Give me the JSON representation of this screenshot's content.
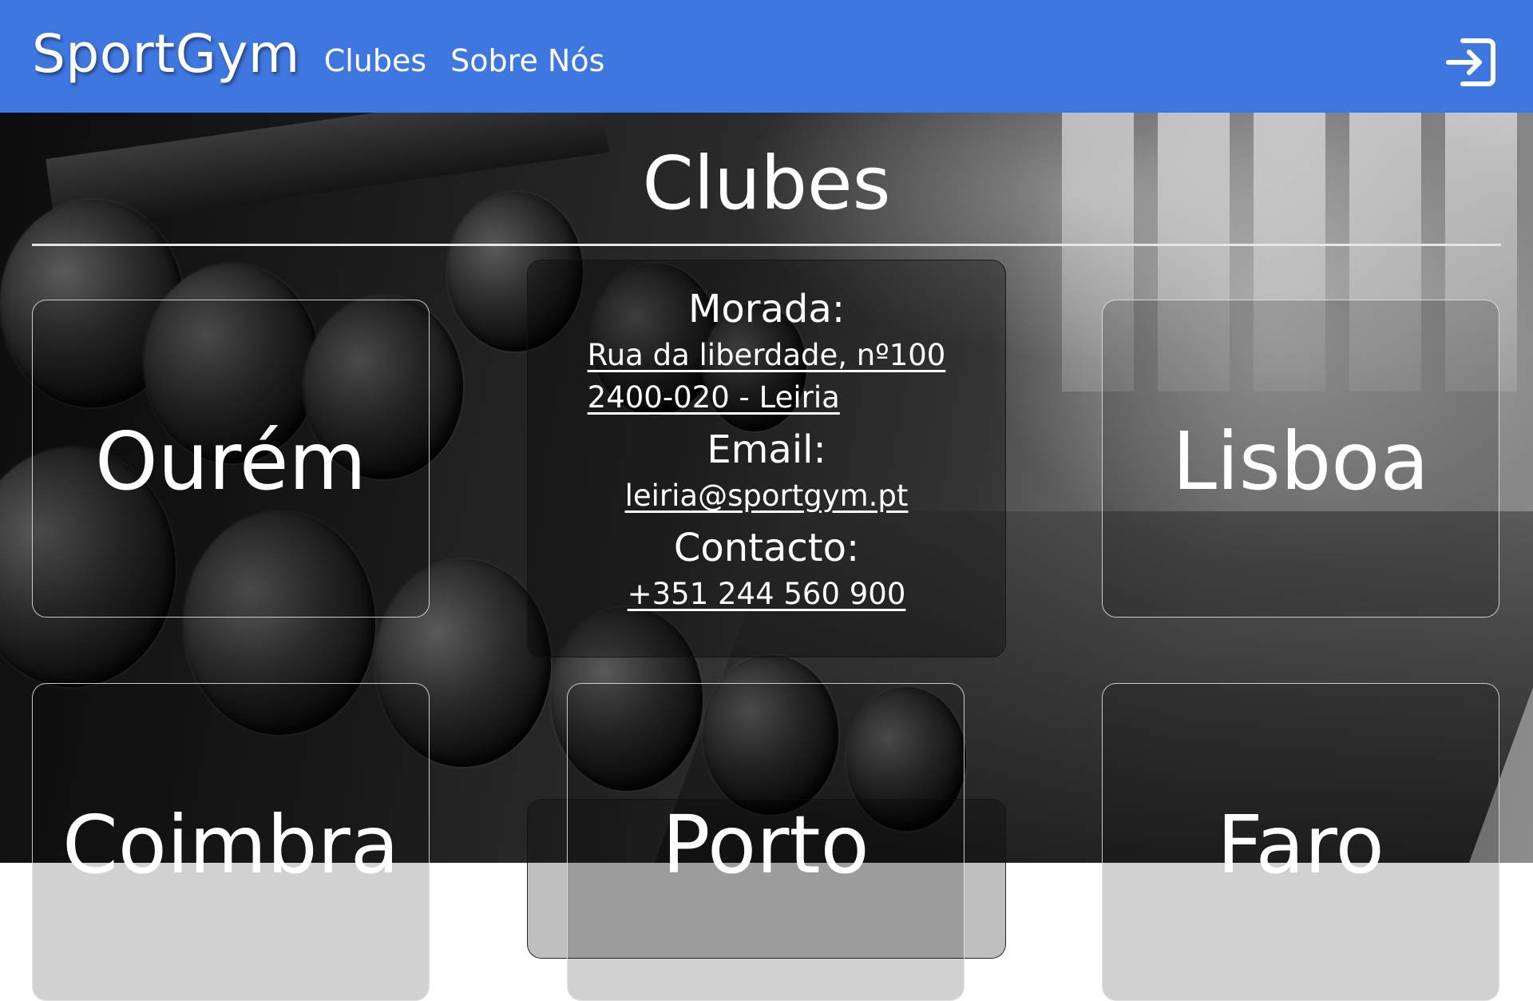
{
  "navbar": {
    "brand": "SportGym",
    "links": [
      "Clubes",
      "Sobre Nós"
    ],
    "color": "#3f77e0",
    "login_icon": "sign-in-icon"
  },
  "main": {
    "title": "Clubes",
    "info": {
      "address_label": "Morada:",
      "address_line1": "Rua da liberdade, nº100",
      "address_line2": "2400-020 - Leiria",
      "email_label": "Email:",
      "email": "leiria@sportgym.pt",
      "contact_label": "Contacto:",
      "phone": "+351 244 560 900"
    },
    "clubs": [
      "Ourém",
      "Lisboa",
      "Coimbra",
      "Porto",
      "Faro"
    ]
  }
}
